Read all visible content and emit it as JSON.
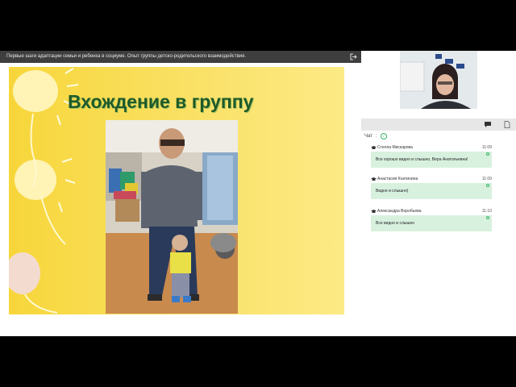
{
  "presentation": {
    "title": "Первые шаги адаптации семьи и ребенка в социуме. Опыт группы детско-родительского взаимодействия.",
    "slide_title": "Вхождение в группу"
  },
  "chat": {
    "header_label": "Чат",
    "messages": [
      {
        "author": "Стелла Мискарова",
        "time": "11:09",
        "text": "Все хорошо видно и слышно, Вера Анатольевна!"
      },
      {
        "author": "Анастасия Кнатинина",
        "time": "11:09",
        "text": "Видно и слышно)"
      },
      {
        "author": "Александра Воробьева",
        "time": "11:10",
        "text": "Все видно и слышно"
      }
    ]
  },
  "colors": {
    "accent": "#38b56a",
    "bubble": "#d8f1df",
    "slide_title": "#1f5a2a"
  }
}
